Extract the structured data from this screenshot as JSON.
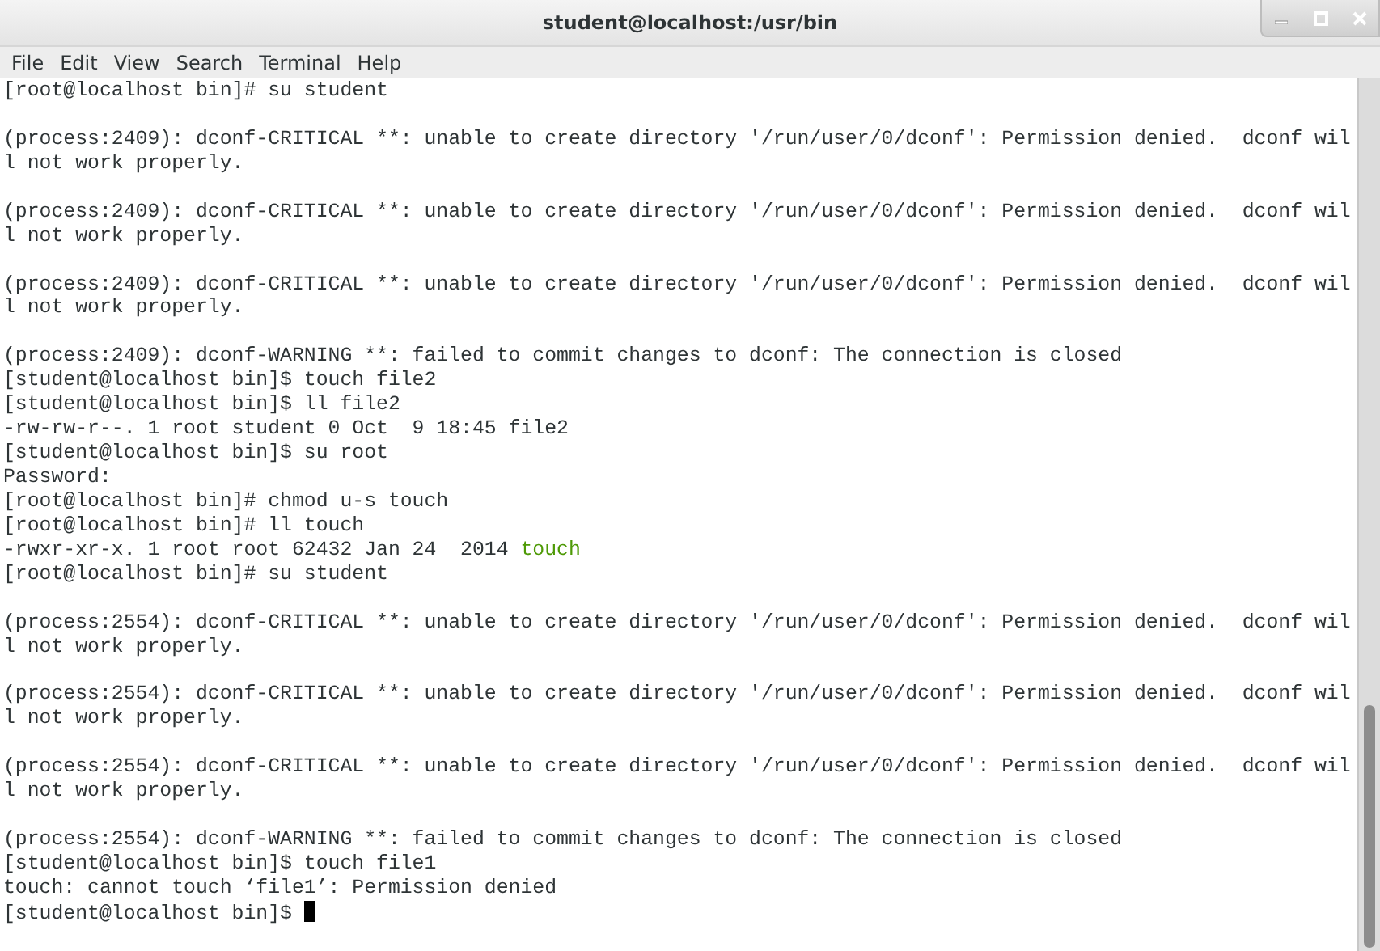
{
  "window": {
    "title": "student@localhost:/usr/bin"
  },
  "menu": [
    "File",
    "Edit",
    "View",
    "Search",
    "Terminal",
    "Help"
  ],
  "terminal": {
    "cursor": true,
    "lines": [
      {
        "kind": "text",
        "parts": [
          {
            "text": "[root@localhost bin]# su student"
          }
        ]
      },
      {
        "kind": "blank"
      },
      {
        "kind": "text",
        "parts": [
          {
            "text": "(process:2409): dconf-CRITICAL **: unable to create directory '/run/user/0/dconf': Permission denied.  dconf wil"
          }
        ]
      },
      {
        "kind": "text",
        "parts": [
          {
            "text": "l not work properly."
          }
        ]
      },
      {
        "kind": "blank"
      },
      {
        "kind": "text",
        "parts": [
          {
            "text": "(process:2409): dconf-CRITICAL **: unable to create directory '/run/user/0/dconf': Permission denied.  dconf wil"
          }
        ]
      },
      {
        "kind": "text",
        "parts": [
          {
            "text": "l not work properly."
          }
        ]
      },
      {
        "kind": "blank"
      },
      {
        "kind": "text",
        "parts": [
          {
            "text": "(process:2409): dconf-CRITICAL **: unable to create directory '/run/user/0/dconf': Permission denied.  dconf wil"
          }
        ]
      },
      {
        "kind": "text",
        "parts": [
          {
            "text": "l not work properly."
          }
        ]
      },
      {
        "kind": "blank"
      },
      {
        "kind": "text",
        "parts": [
          {
            "text": "(process:2409): dconf-WARNING **: failed to commit changes to dconf: The connection is closed"
          }
        ]
      },
      {
        "kind": "text",
        "parts": [
          {
            "text": "[student@localhost bin]$ touch file2"
          }
        ]
      },
      {
        "kind": "text",
        "parts": [
          {
            "text": "[student@localhost bin]$ ll file2"
          }
        ]
      },
      {
        "kind": "text",
        "parts": [
          {
            "text": "-rw-rw-r--. 1 root student 0 Oct  9 18:45 file2"
          }
        ]
      },
      {
        "kind": "text",
        "parts": [
          {
            "text": "[student@localhost bin]$ su root"
          }
        ]
      },
      {
        "kind": "text",
        "parts": [
          {
            "text": "Password:"
          }
        ]
      },
      {
        "kind": "text",
        "parts": [
          {
            "text": "[root@localhost bin]# chmod u-s touch"
          }
        ]
      },
      {
        "kind": "text",
        "parts": [
          {
            "text": "[root@localhost bin]# ll touch"
          }
        ]
      },
      {
        "kind": "text",
        "parts": [
          {
            "text": "-rwxr-xr-x. 1 root root 62432 Jan 24  2014 "
          },
          {
            "text": "touch",
            "color": "#4e9a06"
          }
        ]
      },
      {
        "kind": "text",
        "parts": [
          {
            "text": "[root@localhost bin]# su student"
          }
        ]
      },
      {
        "kind": "blank"
      },
      {
        "kind": "text",
        "parts": [
          {
            "text": "(process:2554): dconf-CRITICAL **: unable to create directory '/run/user/0/dconf': Permission denied.  dconf wil"
          }
        ]
      },
      {
        "kind": "text",
        "parts": [
          {
            "text": "l not work properly."
          }
        ]
      },
      {
        "kind": "blank"
      },
      {
        "kind": "text",
        "parts": [
          {
            "text": "(process:2554): dconf-CRITICAL **: unable to create directory '/run/user/0/dconf': Permission denied.  dconf wil"
          }
        ]
      },
      {
        "kind": "text",
        "parts": [
          {
            "text": "l not work properly."
          }
        ]
      },
      {
        "kind": "blank"
      },
      {
        "kind": "text",
        "parts": [
          {
            "text": "(process:2554): dconf-CRITICAL **: unable to create directory '/run/user/0/dconf': Permission denied.  dconf wil"
          }
        ]
      },
      {
        "kind": "text",
        "parts": [
          {
            "text": "l not work properly."
          }
        ]
      },
      {
        "kind": "blank"
      },
      {
        "kind": "text",
        "parts": [
          {
            "text": "(process:2554): dconf-WARNING **: failed to commit changes to dconf: The connection is closed"
          }
        ]
      },
      {
        "kind": "text",
        "parts": [
          {
            "text": "[student@localhost bin]$ touch file1"
          }
        ]
      },
      {
        "kind": "text",
        "parts": [
          {
            "text": "touch: cannot touch ‘file1’: Permission denied"
          }
        ]
      },
      {
        "kind": "text",
        "parts": [
          {
            "text": "[student@localhost bin]$ "
          }
        ]
      }
    ]
  }
}
